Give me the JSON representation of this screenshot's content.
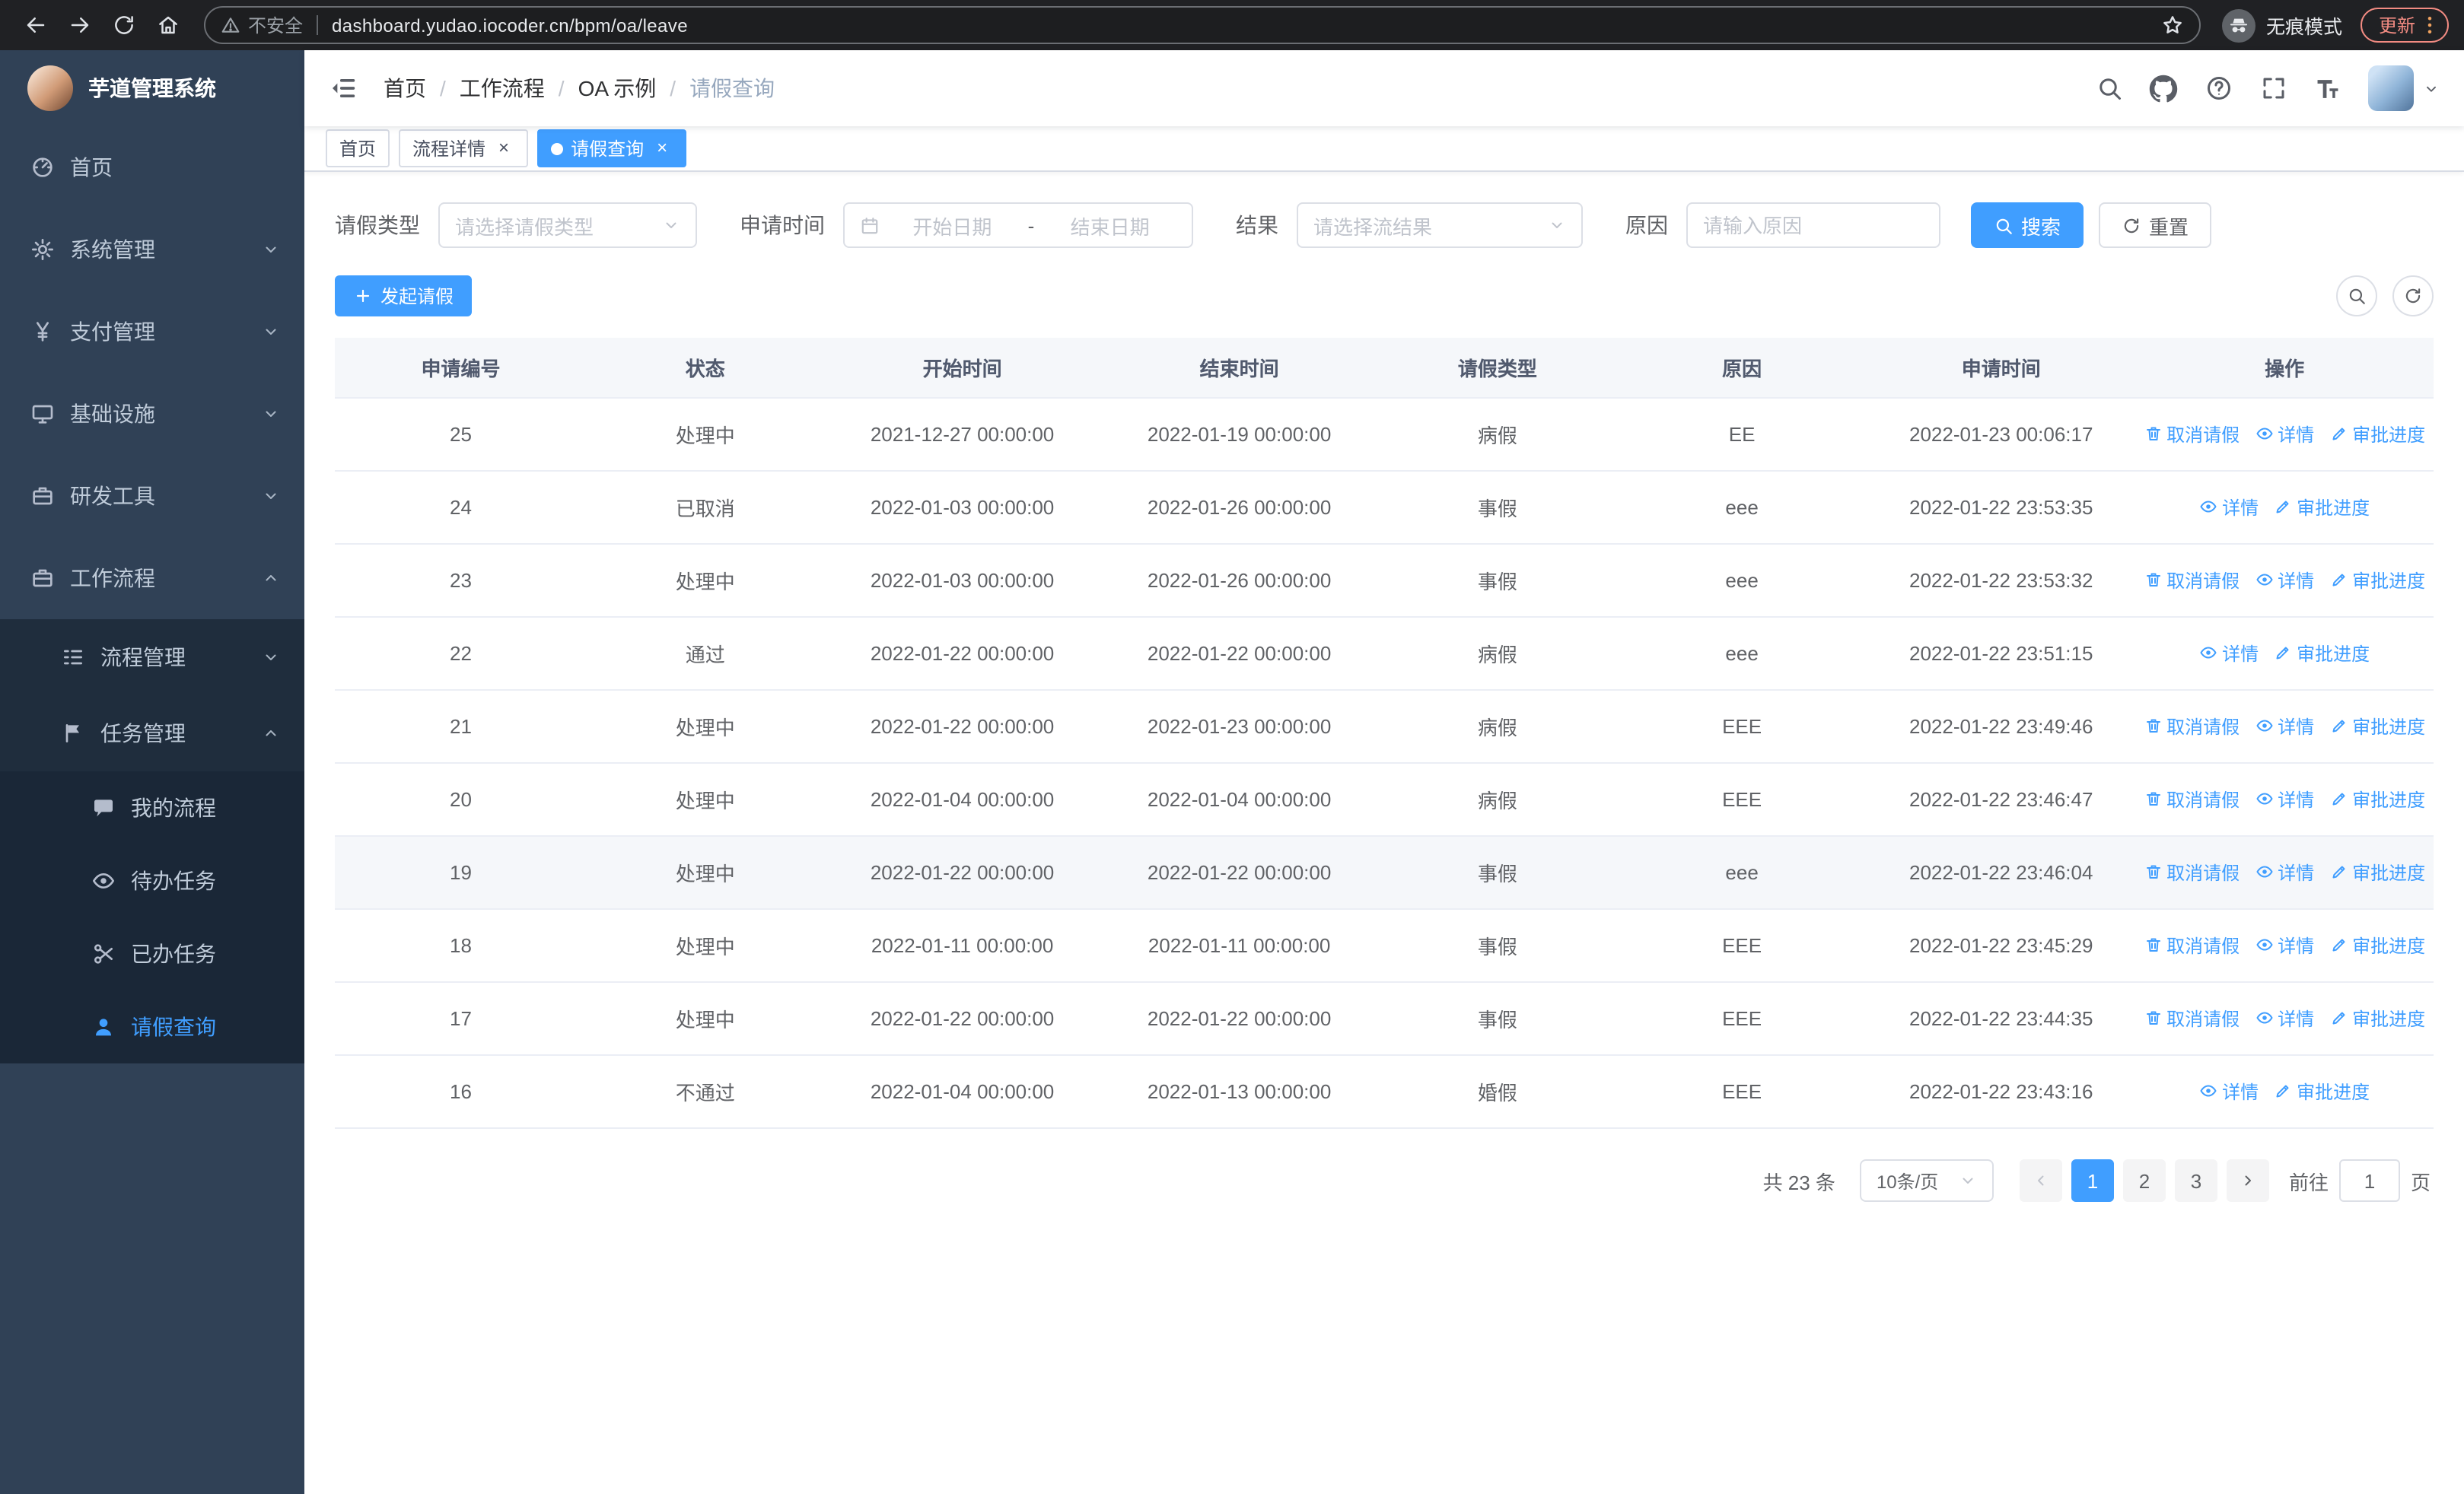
{
  "browser": {
    "security_warning": "不安全",
    "url": "dashboard.yudao.iocoder.cn/bpm/oa/leave",
    "incognito_label": "无痕模式",
    "update_label": "更新"
  },
  "sidebar": {
    "logo_title": "芋道管理系统",
    "menu": [
      {
        "key": "home",
        "label": "首页",
        "icon": "gauge",
        "level": 1
      },
      {
        "key": "system-management",
        "label": "系统管理",
        "icon": "gear",
        "level": 1,
        "chevron": "down"
      },
      {
        "key": "payment-management",
        "label": "支付管理",
        "icon": "yen",
        "level": 1,
        "chevron": "down"
      },
      {
        "key": "infrastructure",
        "label": "基础设施",
        "icon": "monitor",
        "level": 1,
        "chevron": "down"
      },
      {
        "key": "dev-tools",
        "label": "研发工具",
        "icon": "briefcase",
        "level": 1,
        "chevron": "down"
      },
      {
        "key": "workflow",
        "label": "工作流程",
        "icon": "briefcase",
        "level": 1,
        "chevron": "up"
      },
      {
        "key": "process-management",
        "label": "流程管理",
        "icon": "list",
        "level": 2,
        "chevron": "down"
      },
      {
        "key": "task-management",
        "label": "任务管理",
        "icon": "flag",
        "level": 2,
        "chevron": "up"
      },
      {
        "key": "my-process",
        "label": "我的流程",
        "icon": "chat",
        "level": 3
      },
      {
        "key": "todo-tasks",
        "label": "待办任务",
        "icon": "eye",
        "level": 3
      },
      {
        "key": "done-tasks",
        "label": "已办任务",
        "icon": "scissors",
        "level": 3
      },
      {
        "key": "leave-query",
        "label": "请假查询",
        "icon": "user",
        "level": 3,
        "active": true
      }
    ]
  },
  "header": {
    "breadcrumb": [
      "首页",
      "工作流程",
      "OA 示例",
      "请假查询"
    ]
  },
  "tabs": [
    {
      "key": "home",
      "label": "首页",
      "closable": false,
      "active": false
    },
    {
      "key": "process-detail",
      "label": "流程详情",
      "closable": true,
      "active": false
    },
    {
      "key": "leave-query",
      "label": "请假查询",
      "closable": true,
      "active": true
    }
  ],
  "filters": {
    "leave_type_label": "请假类型",
    "leave_type_placeholder": "请选择请假类型",
    "apply_time_label": "申请时间",
    "start_date_placeholder": "开始日期",
    "date_separator": "-",
    "end_date_placeholder": "结束日期",
    "result_label": "结果",
    "result_placeholder": "请选择流结果",
    "reason_label": "原因",
    "reason_placeholder": "请输入原因",
    "search_button": "搜索",
    "reset_button": "重置"
  },
  "toolbar": {
    "create_button": "发起请假"
  },
  "table": {
    "columns": [
      "申请编号",
      "状态",
      "开始时间",
      "结束时间",
      "请假类型",
      "原因",
      "申请时间",
      "操作"
    ],
    "action_defs": {
      "cancel": {
        "label": "取消请假",
        "icon": "trash"
      },
      "detail": {
        "label": "详情",
        "icon": "eye"
      },
      "progress": {
        "label": "审批进度",
        "icon": "edit"
      }
    },
    "rows": [
      {
        "id": "25",
        "status": "处理中",
        "start": "2021-12-27 00:00:00",
        "end": "2022-01-19 00:00:00",
        "type": "病假",
        "reason": "EE",
        "applied": "2022-01-23 00:06:17",
        "highlighted": false,
        "actions": [
          "cancel",
          "detail",
          "progress"
        ]
      },
      {
        "id": "24",
        "status": "已取消",
        "start": "2022-01-03 00:00:00",
        "end": "2022-01-26 00:00:00",
        "type": "事假",
        "reason": "eee",
        "applied": "2022-01-22 23:53:35",
        "highlighted": false,
        "actions": [
          "detail",
          "progress"
        ]
      },
      {
        "id": "23",
        "status": "处理中",
        "start": "2022-01-03 00:00:00",
        "end": "2022-01-26 00:00:00",
        "type": "事假",
        "reason": "eee",
        "applied": "2022-01-22 23:53:32",
        "highlighted": false,
        "actions": [
          "cancel",
          "detail",
          "progress"
        ]
      },
      {
        "id": "22",
        "status": "通过",
        "start": "2022-01-22 00:00:00",
        "end": "2022-01-22 00:00:00",
        "type": "病假",
        "reason": "eee",
        "applied": "2022-01-22 23:51:15",
        "highlighted": false,
        "actions": [
          "detail",
          "progress"
        ]
      },
      {
        "id": "21",
        "status": "处理中",
        "start": "2022-01-22 00:00:00",
        "end": "2022-01-23 00:00:00",
        "type": "病假",
        "reason": "EEE",
        "applied": "2022-01-22 23:49:46",
        "highlighted": false,
        "actions": [
          "cancel",
          "detail",
          "progress"
        ]
      },
      {
        "id": "20",
        "status": "处理中",
        "start": "2022-01-04 00:00:00",
        "end": "2022-01-04 00:00:00",
        "type": "病假",
        "reason": "EEE",
        "applied": "2022-01-22 23:46:47",
        "highlighted": false,
        "actions": [
          "cancel",
          "detail",
          "progress"
        ]
      },
      {
        "id": "19",
        "status": "处理中",
        "start": "2022-01-22 00:00:00",
        "end": "2022-01-22 00:00:00",
        "type": "事假",
        "reason": "eee",
        "applied": "2022-01-22 23:46:04",
        "highlighted": true,
        "actions": [
          "cancel",
          "detail",
          "progress"
        ]
      },
      {
        "id": "18",
        "status": "处理中",
        "start": "2022-01-11 00:00:00",
        "end": "2022-01-11 00:00:00",
        "type": "事假",
        "reason": "EEE",
        "applied": "2022-01-22 23:45:29",
        "highlighted": false,
        "actions": [
          "cancel",
          "detail",
          "progress"
        ]
      },
      {
        "id": "17",
        "status": "处理中",
        "start": "2022-01-22 00:00:00",
        "end": "2022-01-22 00:00:00",
        "type": "事假",
        "reason": "EEE",
        "applied": "2022-01-22 23:44:35",
        "highlighted": false,
        "actions": [
          "cancel",
          "detail",
          "progress"
        ]
      },
      {
        "id": "16",
        "status": "不通过",
        "start": "2022-01-04 00:00:00",
        "end": "2022-01-13 00:00:00",
        "type": "婚假",
        "reason": "EEE",
        "applied": "2022-01-22 23:43:16",
        "highlighted": false,
        "actions": [
          "detail",
          "progress"
        ]
      }
    ]
  },
  "pagination": {
    "total": "共 23 条",
    "page_size": "10条/页",
    "pages": [
      "1",
      "2",
      "3"
    ],
    "active_page": "1",
    "goto_label": "前往",
    "goto_value": "1",
    "page_label": "页"
  },
  "colors": {
    "primary": "#409eff",
    "sidebar_bg": "#304156",
    "submenu_bg": "#1f2d3d",
    "update_pill": "#f28b82"
  }
}
